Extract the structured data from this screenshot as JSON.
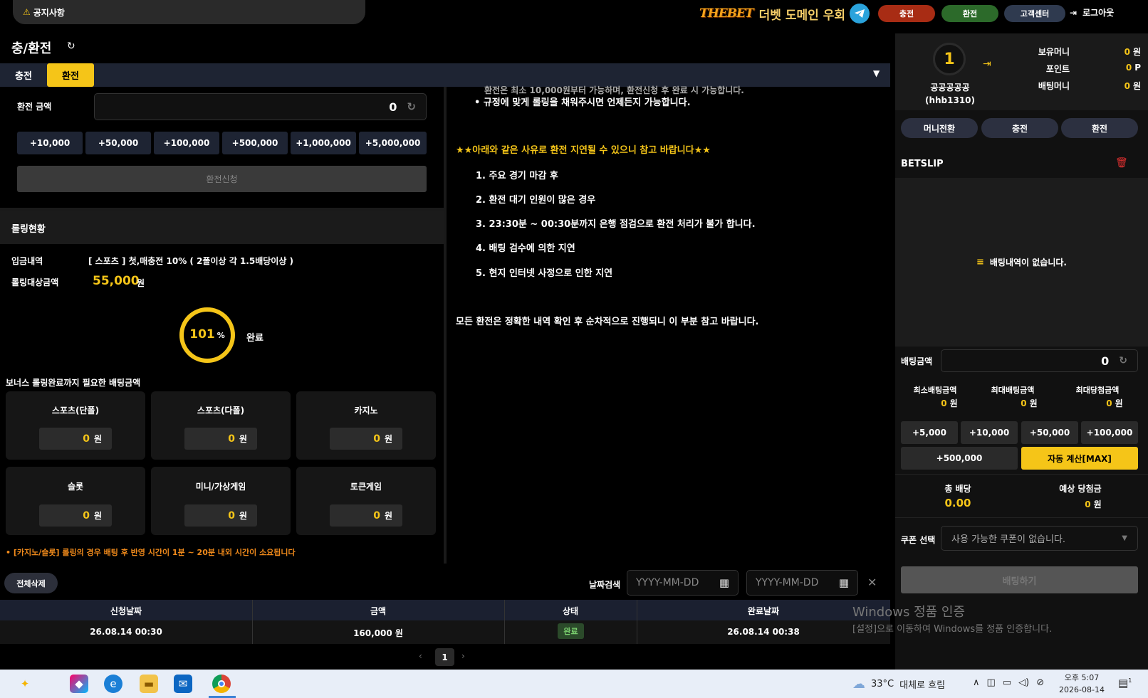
{
  "topbar": {
    "notice_icon": "⚠",
    "notice_label": "공지사항",
    "logo_mark": "THEBET",
    "logo_text": "더벳 도메인 우회",
    "btn_deposit": "충전",
    "btn_withdraw": "환전",
    "btn_support": "고객센터",
    "logout": "로그아웃"
  },
  "page": {
    "title": "충/환전"
  },
  "tabs": {
    "deposit": "충전",
    "withdraw": "환전"
  },
  "form": {
    "amount_label": "환전 금액",
    "amount_value": "0",
    "quick_amounts": [
      "+10,000",
      "+50,000",
      "+100,000",
      "+500,000",
      "+1,000,000",
      "+5,000,000"
    ],
    "request_button": "환전신청"
  },
  "rolling": {
    "header": "롤링현황",
    "deposit_history_label": "입금내역",
    "deposit_history_value": "[ 스포츠 ] 첫,매충전 10% ( 2폴이상 각 1.5배당이상 )",
    "target_label": "롤링대상금액",
    "target_value": "55,000",
    "target_unit": "원",
    "progress_percent": "101",
    "percent_sign": "%",
    "progress_fraction": 1.0,
    "status": "완료",
    "bonus_label": "보너스 롤링완료까지 필요한 배팅금액",
    "games": [
      {
        "name": "스포츠(단폴)",
        "value": "0",
        "unit": "원"
      },
      {
        "name": "스포츠(다폴)",
        "value": "0",
        "unit": "원"
      },
      {
        "name": "카지노",
        "value": "0",
        "unit": "원"
      },
      {
        "name": "슬롯",
        "value": "0",
        "unit": "원"
      },
      {
        "name": "미니/가상게임",
        "value": "0",
        "unit": "원"
      },
      {
        "name": "토큰게임",
        "value": "0",
        "unit": "원"
      }
    ],
    "casino_note": "• [카지노/슬롯] 롤링의 경우 배팅 후 반영 시간이 1분 ~ 20분 내외 시간이 소요됩니다"
  },
  "notice": {
    "top_line": "환전은 최소 10,000원부터 가능하며, 환전신청 후 완료 시 가능합니다.",
    "rule": "규정에 맞게 롤링을 채워주시면 언제든지 가능합니다.",
    "warning": "★★아래와 같은 사유로 환전 지연될 수 있으니 참고 바랍니다★★",
    "reasons": [
      "1. 주요 경기 마감 후",
      "2. 환전 대기 인원이 많은 경우",
      "3. 23:30분 ~ 00:30분까지 은행 점검으로 환전 처리가 불가 합니다.",
      "4. 배팅 검수에 의한 지연",
      "5. 현지 인터넷 사정으로 인한 지연"
    ],
    "final": "모든 환전은 정확한 내역 확인 후 순차적으로 진행되니 이 부분 참고 바랍니다."
  },
  "history": {
    "delete_all": "전체삭제",
    "date_search_label": "날짜검색",
    "date_placeholder": "YYYY-MM-DD",
    "columns": [
      "신청날짜",
      "금액",
      "상태",
      "완료날짜"
    ],
    "rows": [
      {
        "requested": "26.08.14 00:30",
        "amount": "160,000 원",
        "status": "완료",
        "completed": "26.08.14 00:38"
      }
    ],
    "page": "1"
  },
  "user": {
    "level": "1",
    "name": "공공공공공",
    "id": "(hhb1310)",
    "balances": [
      {
        "label": "보유머니",
        "value": "0",
        "unit": "원"
      },
      {
        "label": "포인트",
        "value": "0",
        "unit": "P"
      },
      {
        "label": "배팅머니",
        "value": "0",
        "unit": "원"
      }
    ],
    "buttons": [
      "머니전환",
      "충전",
      "환전"
    ]
  },
  "betslip": {
    "title": "BETSLIP",
    "empty": "배팅내역이 없습니다.",
    "amount_label": "배팅금액",
    "amount_value": "0",
    "limits": [
      {
        "label": "최소배팅금액",
        "value": "0",
        "unit": "원"
      },
      {
        "label": "최대배팅금액",
        "value": "0",
        "unit": "원"
      },
      {
        "label": "최대당첨금액",
        "value": "0",
        "unit": "원"
      }
    ],
    "quick": [
      "+5,000",
      "+10,000",
      "+50,000",
      "+100,000",
      "+500,000"
    ],
    "auto_max": "자동 계산[MAX]",
    "total_odds_label": "총 배당",
    "total_odds_value": "0.00",
    "expected_label": "예상 당첨금",
    "expected_value": "0",
    "expected_unit": "원",
    "coupon_label": "쿠폰 선택",
    "coupon_value": "사용 가능한 쿠폰이 없습니다.",
    "bet_button": "배팅하기"
  },
  "watermark": {
    "title": "Windows 정품 인증",
    "subtitle": "[설정]으로 이동하여 Windows를 정품 인증합니다."
  },
  "taskbar": {
    "weather_temp": "33°C",
    "weather_text": "대체로 흐림",
    "time": "오후 5:07",
    "date": "2026-08-14",
    "notify_count": "1"
  },
  "colors": {
    "accent": "#f5c518",
    "deposit": "#a82c14",
    "withdraw": "#2c6a2a"
  }
}
